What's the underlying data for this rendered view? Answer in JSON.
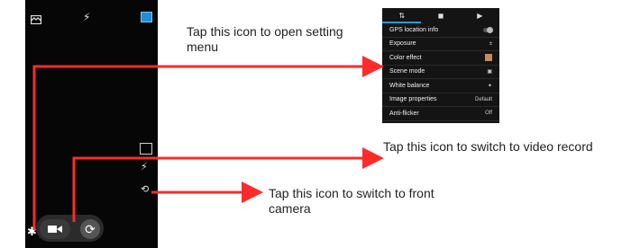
{
  "camera": {
    "icons": {
      "top_left": "panorama-icon",
      "top_mid": "flash-icon",
      "top_right": "gallery-icon",
      "side_1": "hdr-icon",
      "side_2": "flash-mode-icon",
      "side_3": "switch-camera-icon",
      "bottom_left": "gear-icon",
      "bottom_video": "video-icon",
      "bottom_shutter": "shutter-icon"
    },
    "glyphs": {
      "top_mid": "⚡",
      "side_2": "⚡",
      "side_3": "⟲",
      "gear": "✱",
      "video": "▶",
      "shutter": "⟳"
    }
  },
  "settings_menu": {
    "tabs": [
      "⇅",
      "◼",
      "▶"
    ],
    "rows": [
      {
        "label": "GPS location info",
        "value": ""
      },
      {
        "label": "Exposure",
        "value": "±"
      },
      {
        "label": "Color effect",
        "value": ""
      },
      {
        "label": "Scene mode",
        "value": "▣"
      },
      {
        "label": "White balance",
        "value": "✦"
      },
      {
        "label": "Image properties",
        "value": "Default"
      },
      {
        "label": "Anti-flicker",
        "value": "Off"
      }
    ]
  },
  "callouts": {
    "settings": "Tap this icon to open setting menu",
    "video": "Tap this icon to switch to video record",
    "front_camera": "Tap this icon to switch to front camera"
  },
  "colors": {
    "arrow": "#ff2a2a",
    "accent_blue": "#2b9ad8"
  }
}
